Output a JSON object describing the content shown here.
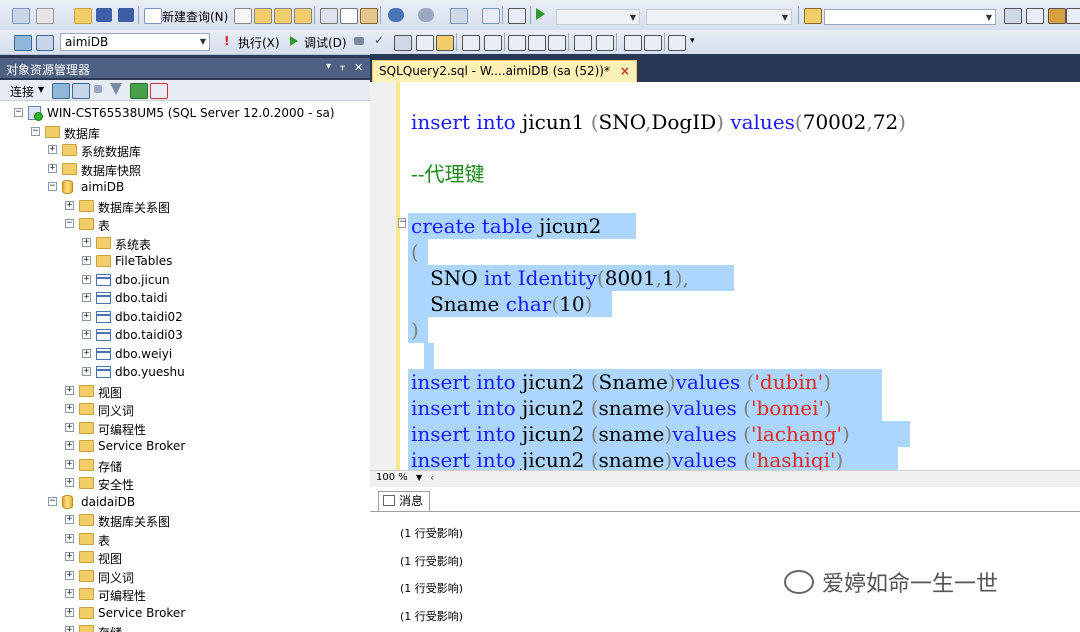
{
  "toolbar": {
    "new_query_label": "新建查询(N)",
    "database": "aimiDB",
    "execute_label": "执行(X)",
    "debug_label": "调试(D)"
  },
  "object_explorer": {
    "title": "对象资源管理器",
    "title_buttons": [
      "▾",
      "ᚁ",
      "✕"
    ],
    "connect_label": "连接",
    "tree": [
      {
        "label": "WIN-CST65538UM5 (SQL Server 12.0.2000 - sa)",
        "icon": "server-icon",
        "expander": "−"
      },
      {
        "label": "数据库",
        "icon": "folder-icon",
        "expander": "−"
      },
      {
        "label": "系统数据库",
        "icon": "folder-icon",
        "expander": "+"
      },
      {
        "label": "数据库快照",
        "icon": "folder-icon",
        "expander": "+"
      },
      {
        "label": "aimiDB",
        "icon": "database-icon",
        "expander": "−"
      },
      {
        "label": "数据库关系图",
        "icon": "folder-icon",
        "expander": "+"
      },
      {
        "label": "表",
        "icon": "folder-icon",
        "expander": "−"
      },
      {
        "label": "系统表",
        "icon": "folder-icon",
        "expander": "+"
      },
      {
        "label": "FileTables",
        "icon": "folder-icon",
        "expander": "+"
      },
      {
        "label": "dbo.jicun",
        "icon": "table-icon",
        "expander": "+"
      },
      {
        "label": "dbo.taidi",
        "icon": "table-icon",
        "expander": "+"
      },
      {
        "label": "dbo.taidi02",
        "icon": "table-icon",
        "expander": "+"
      },
      {
        "label": "dbo.taidi03",
        "icon": "table-icon",
        "expander": "+"
      },
      {
        "label": "dbo.weiyi",
        "icon": "table-icon",
        "expander": "+"
      },
      {
        "label": "dbo.yueshu",
        "icon": "table-icon",
        "expander": "+"
      },
      {
        "label": "视图",
        "icon": "folder-icon",
        "expander": "+"
      },
      {
        "label": "同义词",
        "icon": "folder-icon",
        "expander": "+"
      },
      {
        "label": "可编程性",
        "icon": "folder-icon",
        "expander": "+"
      },
      {
        "label": "Service Broker",
        "icon": "folder-icon",
        "expander": "+"
      },
      {
        "label": "存储",
        "icon": "folder-icon",
        "expander": "+"
      },
      {
        "label": "安全性",
        "icon": "folder-icon",
        "expander": "+"
      },
      {
        "label": "daidaiDB",
        "icon": "database-icon",
        "expander": "−"
      },
      {
        "label": "数据库关系图",
        "icon": "folder-icon",
        "expander": "+"
      },
      {
        "label": "表",
        "icon": "folder-icon",
        "expander": "+"
      },
      {
        "label": "视图",
        "icon": "folder-icon",
        "expander": "+"
      },
      {
        "label": "同义词",
        "icon": "folder-icon",
        "expander": "+"
      },
      {
        "label": "可编程性",
        "icon": "folder-icon",
        "expander": "+"
      },
      {
        "label": "Service Broker",
        "icon": "folder-icon",
        "expander": "+"
      },
      {
        "label": "存储",
        "icon": "folder-icon",
        "expander": "+"
      }
    ]
  },
  "editor": {
    "tab_label": "SQLQuery2.sql - W....aimiDB (sa (52))*",
    "tab_close": "×",
    "code": {
      "l1": [
        "insert",
        " ",
        "into",
        " jicun1 ",
        "(",
        "SNO",
        ",",
        "DogID",
        ")",
        " ",
        "values",
        "(",
        "70002",
        ",",
        "72",
        ")"
      ],
      "l2": "--代理键",
      "l3": [
        "create",
        " ",
        "table",
        " jicun2"
      ],
      "l4": "(",
      "l5": [
        "   SNO ",
        "int",
        " ",
        "Identity",
        "(",
        "8001",
        ",",
        "1",
        ")",
        ","
      ],
      "l6": [
        "   Sname ",
        "char",
        "(",
        "10",
        ")"
      ],
      "l7": ")",
      "inserts": [
        {
          "into": "insert",
          "kw2": "into",
          "table": " jicun2 ",
          "col": "Sname",
          "values": "values",
          "str": "'dubin'"
        },
        {
          "into": "insert",
          "kw2": "into",
          "table": " jicun2 ",
          "col": "sname",
          "values": "values",
          "str": "'bomei'"
        },
        {
          "into": "insert",
          "kw2": "into",
          "table": " jicun2 ",
          "col": "sname",
          "values": "values",
          "str": "'lachang'"
        },
        {
          "into": "insert",
          "kw2": "into",
          "table": " jicun2 ",
          "col": "sname",
          "values": "values",
          "str": "'hashiqi'"
        }
      ]
    },
    "zoom": "100 %"
  },
  "results": {
    "tab_label": "消息",
    "messages": [
      "(1 行受影响)",
      "(1 行受影响)",
      "(1 行受影响)",
      "(1 行受影响)"
    ]
  },
  "watermark": "爱婷如命一生一世",
  "colors": {
    "keyword": "#1a1aff",
    "string": "#e0281e",
    "comment": "#1e8a1e",
    "selection": "#add6ff",
    "chrome": "#293955"
  }
}
